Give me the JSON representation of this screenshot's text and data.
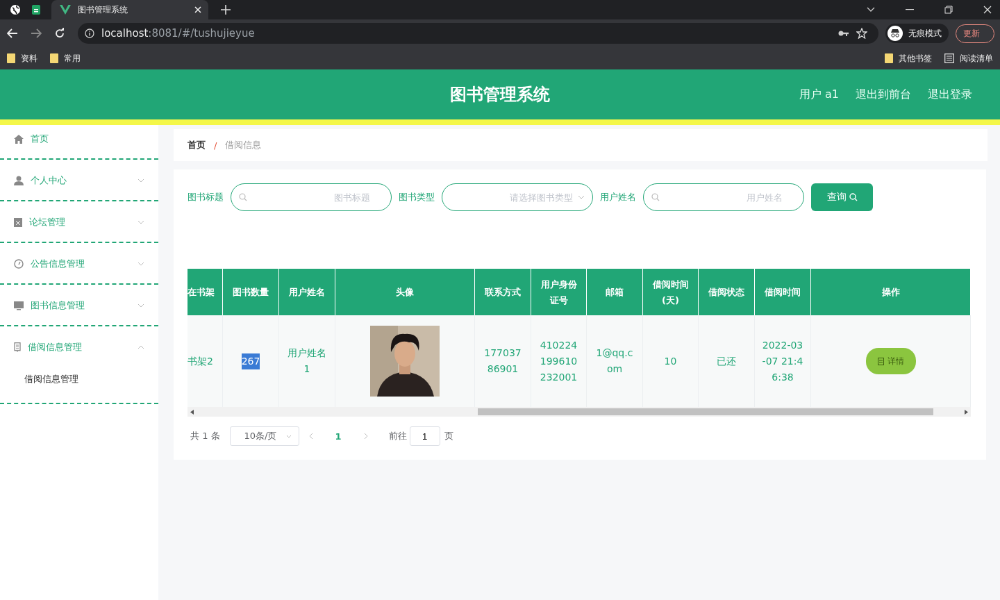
{
  "browser": {
    "tabs": [
      {
        "title": "图书管理系统",
        "selected": true
      }
    ],
    "address": {
      "host": "localhost",
      "path": ":8081/#/tushujieyue"
    },
    "profile": "无痕模式",
    "update_button": "更新",
    "bookmarks": [
      "资料",
      "常用"
    ],
    "other_bookmarks": "其他书签",
    "reading_list": "阅读清单"
  },
  "header": {
    "title": "图书管理系统",
    "links": [
      "用户 a1",
      "退出到前台",
      "退出登录"
    ]
  },
  "sidebar": {
    "items": [
      {
        "label": "首页",
        "kind": "link"
      },
      {
        "label": "个人中心",
        "kind": "submenu",
        "expanded": false
      },
      {
        "label": "论坛管理",
        "kind": "submenu",
        "expanded": false
      },
      {
        "label": "公告信息管理",
        "kind": "submenu",
        "expanded": false
      },
      {
        "label": "图书信息管理",
        "kind": "submenu",
        "expanded": false
      },
      {
        "label": "借阅信息管理",
        "kind": "submenu",
        "expanded": true,
        "children": [
          {
            "label": "借阅信息管理"
          }
        ]
      }
    ]
  },
  "breadcrumb": {
    "separator": "/",
    "items": [
      "首页",
      "借阅信息"
    ]
  },
  "search": {
    "fields": [
      {
        "label": "图书标题",
        "kind": "input",
        "placeholder": "图书标题"
      },
      {
        "label": "图书类型",
        "kind": "select",
        "placeholder": "请选择图书类型"
      },
      {
        "label": "用户姓名",
        "kind": "input",
        "placeholder": "用户姓名"
      }
    ],
    "button": "查询"
  },
  "table": {
    "columns": [
      "在书架",
      "图书数量",
      "用户姓名",
      "头像",
      "联系方式",
      "用户身份证号",
      "邮箱",
      "借阅时间(天)",
      "借阅状态",
      "借阅时间",
      "操作"
    ],
    "rows": [
      {
        "cells": [
          "书架2",
          "267",
          "用户姓名1",
          {
            "kind": "picture"
          },
          "17703786901",
          "410224199610232001",
          "1@qq.com",
          "10",
          "已还",
          "2022-03-07 21:46:38"
        ],
        "action": "详情"
      }
    ]
  },
  "pagination": {
    "total": "共 1 条",
    "page_size": "10条/页",
    "pages": [
      {
        "label": "1",
        "selected": true
      }
    ],
    "goto_label": "前往",
    "goto_value": "1",
    "goto_suffix": "页"
  }
}
